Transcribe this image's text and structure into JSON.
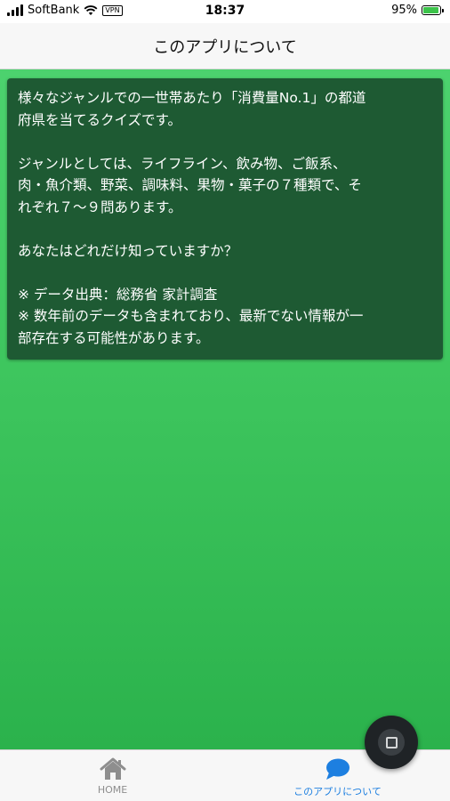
{
  "status_bar": {
    "carrier": "SoftBank",
    "vpn": "VPN",
    "time": "18:37",
    "battery": "95%",
    "battery_level": 0.95
  },
  "header": {
    "title": "このアプリについて"
  },
  "card": {
    "lines": [
      "様々なジャンルでの一世帯あたり「消費量No.1」の都道",
      "府県を当てるクイズです。",
      "",
      "ジャンルとしては、ライフライン、飲み物、ご飯系、",
      "肉・魚介類、野菜、調味料、果物・菓子の７種類で、そ",
      "れぞれ７〜９問あります。",
      "",
      "あなたはどれだけ知っていますか？",
      "",
      "※ データ出典：総務省 家計調査",
      "※ 数年前のデータも含まれており、最新でない情報が一",
      "部存在する可能性があります。"
    ]
  },
  "tabs": [
    {
      "label": "HOME",
      "icon": "home-icon",
      "active": false
    },
    {
      "label": "このアプリについて",
      "icon": "chat-bubble-icon",
      "active": true
    }
  ],
  "fab": {
    "icon": "stop-square-icon"
  },
  "colors": {
    "accent": "#1d7fe0",
    "card_bg": "#1e5a33",
    "content_top": "#4cd26e",
    "content_bottom": "#2bb24c",
    "inactive": "#8e8e8e"
  }
}
